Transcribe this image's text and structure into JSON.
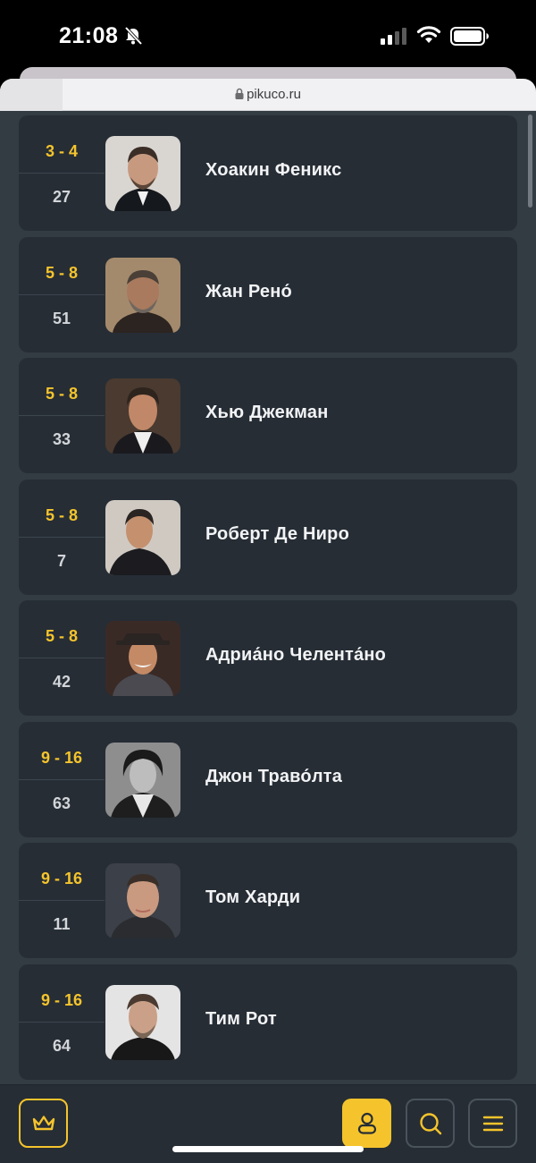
{
  "status_bar": {
    "time": "21:08"
  },
  "browser": {
    "url": "pikuco.ru"
  },
  "colors": {
    "accent": "#f5c42c",
    "card": "#262d35",
    "background": "#333b43"
  },
  "ranking": {
    "items": [
      {
        "rank": "3 - 4",
        "score": "27",
        "name": "Хоакин Феникс",
        "photo": "portrait-joaquin-phoenix"
      },
      {
        "rank": "5 - 8",
        "score": "51",
        "name": "Жан Рено́",
        "photo": "portrait-jean-reno"
      },
      {
        "rank": "5 - 8",
        "score": "33",
        "name": "Хью Джекман",
        "photo": "portrait-hugh-jackman"
      },
      {
        "rank": "5 - 8",
        "score": "7",
        "name": "Роберт Де Ниро",
        "photo": "portrait-robert-de-niro"
      },
      {
        "rank": "5 - 8",
        "score": "42",
        "name": "Адриа́но Челента́но",
        "photo": "portrait-adriano-celentano"
      },
      {
        "rank": "9 - 16",
        "score": "63",
        "name": "Джон Траво́лта",
        "photo": "portrait-john-travolta"
      },
      {
        "rank": "9 - 16",
        "score": "11",
        "name": "Том Харди",
        "photo": "portrait-tom-hardy"
      },
      {
        "rank": "9 - 16",
        "score": "64",
        "name": "Тим Рот",
        "photo": "portrait-tim-roth"
      }
    ]
  },
  "bottom_nav": {
    "buttons": [
      {
        "icon": "crown-icon"
      },
      {
        "icon": "profile-icon"
      },
      {
        "icon": "search-icon"
      },
      {
        "icon": "menu-icon"
      }
    ]
  }
}
